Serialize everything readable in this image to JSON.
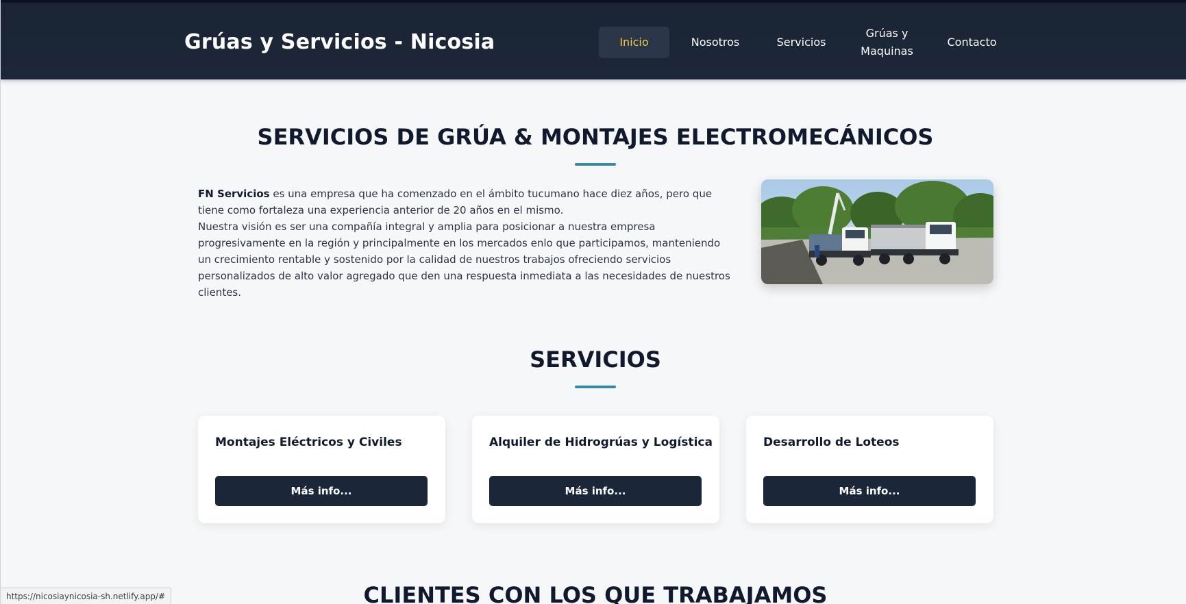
{
  "header": {
    "brand": "Grúas y Servicios - Nicosia",
    "nav": [
      {
        "label": "Inicio",
        "active": true
      },
      {
        "label": "Nosotros"
      },
      {
        "label": "Servicios"
      },
      {
        "label": "Grúas y Maquinas"
      },
      {
        "label": "Contacto"
      }
    ]
  },
  "hero": {
    "title": "SERVICIOS DE GRÚA & MONTAJES ELECTROMECÁNICOS",
    "company": "FN Servicios",
    "p1": " es una empresa que ha comenzado en el ámbito tucumano hace diez años, pero que tiene como fortaleza una experiencia anterior de 20 años en el mismo.",
    "p2": "Nuestra visión es ser una compañía integral y amplia para posicionar a nuestra empresa progresivamente en la región y principalmente en los mercados enlo que participamos, manteniendo un crecimiento rentable y sostenido por la calidad de nuestros trabajos ofreciendo servicios personalizados de alto valor agregado que den una respuesta inmediata a las necesidades de nuestros clientes."
  },
  "services": {
    "title": "SERVICIOS",
    "cards": [
      {
        "title": "Montajes Eléctricos y Civiles",
        "button": "Más info..."
      },
      {
        "title": "Alquiler de Hidrogrúas y Logística",
        "button": "Más info..."
      },
      {
        "title": "Desarrollo de Loteos",
        "button": "Más info..."
      }
    ]
  },
  "clients": {
    "title": "CLIENTES CON LOS QUE TRABAJAMOS"
  },
  "statusbar": {
    "url": "https://nicosiaynicosia-sh.netlify.app/#"
  },
  "colors": {
    "header_bg": "#1a2434",
    "accent_active": "#f2c84b",
    "divider": "#3a86a8",
    "button_bg": "#1c2639"
  }
}
